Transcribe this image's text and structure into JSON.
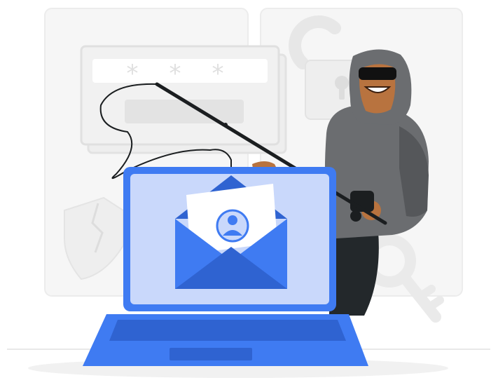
{
  "illustration": {
    "subject": "phishing-scene",
    "password_mask": [
      "*",
      "*",
      "*"
    ],
    "colors": {
      "accent_blue": "#3F7BF2",
      "accent_blue_dark": "#2F63D1",
      "screen_light": "#C9D8FB",
      "panel_gray": "#F4F4F4",
      "panel_border": "#E6E6E6",
      "hoodie_gray": "#6B6D70",
      "hoodie_dark": "#55575A",
      "pants_dark": "#23282B",
      "skin": "#B8733F",
      "mask_black": "#111111",
      "envelope_paper": "#FFFFFF"
    },
    "icons": {
      "password_box": "password-field-icon",
      "padlock": "padlock-icon",
      "shield": "cracked-shield-icon",
      "key": "key-icon",
      "laptop": "laptop-icon",
      "envelope": "envelope-icon",
      "user": "user-avatar-icon",
      "hacker": "hacker-figure",
      "rod": "fishing-rod-icon"
    }
  }
}
